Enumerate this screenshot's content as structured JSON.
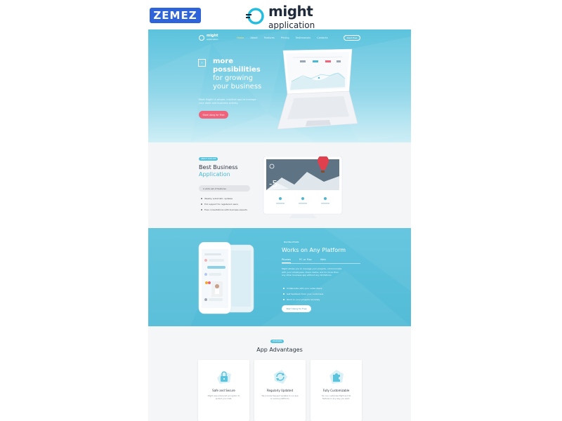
{
  "branding": {
    "vendor": "ZEMEZ",
    "product_title": "might",
    "product_subtitle": "application"
  },
  "nav": {
    "logo_title": "might",
    "logo_subtitle": "application",
    "links": [
      "Home",
      "About",
      "Features",
      "Pricing",
      "Testimonials",
      "Contacts"
    ],
    "active_link": "Home",
    "cta": "Start Free"
  },
  "hero": {
    "title_bold_1": "more",
    "title_bold_2": "possibilities",
    "title_line_3": "for growing",
    "title_line_4": "your business",
    "description": "Meet Might! A simple, intuitive app to manage your work and business activity.",
    "button": "Start Using for Free"
  },
  "business": {
    "tag": "ABOUT OUR APP",
    "title_line_1": "Best Business",
    "title_line_2": "Application",
    "pill": "A wide set of features",
    "features": [
      "Weekly automatic updates",
      "Full support for registered users",
      "Free consultations with business experts"
    ],
    "weather_value": "-5"
  },
  "platform": {
    "tag": "MULTIPLATFORM",
    "title": "Works on Any Platform",
    "tabs": [
      "Phones",
      "PC or Mac",
      "Web"
    ],
    "active_tab": "Phones",
    "description": "Might allows you to manage your projects, communicate with your employees, share media, and do more than any other business app without any limitations.",
    "features": [
      "Collaborate with your subscribers",
      "Get feedback from your customers",
      "Work on your projects remotely"
    ],
    "button": "Start Using for Free"
  },
  "advantages": {
    "tag": "FEATURES",
    "title": "App Advantages",
    "cards": [
      {
        "title": "Safe and Secure",
        "description": "Might uses advanced encryption to protect your data.",
        "icon": "lock-icon"
      },
      {
        "title": "Regularly Updated",
        "description": "We provide frequent updates to our app on various platforms.",
        "icon": "refresh-icon"
      },
      {
        "title": "Fully Customizable",
        "description": "You can customize Might and its features in any way you want.",
        "icon": "puzzle-icon"
      }
    ]
  },
  "colors": {
    "zemez_blue": "#2e63d9",
    "hero_cyan": "#5cc3dd",
    "accent_pink": "#f0637a",
    "accent_cyan": "#4bbad6"
  }
}
